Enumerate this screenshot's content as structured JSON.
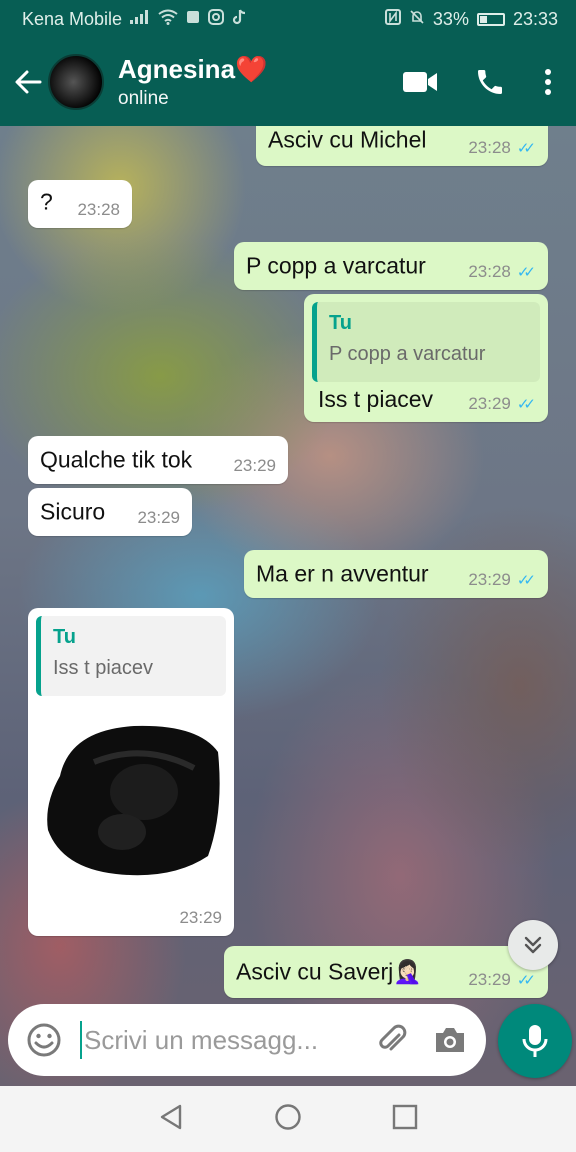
{
  "status_bar": {
    "carrier": "Kena Mobile",
    "battery": "33%",
    "battery_level": 0.33,
    "time": "23:33"
  },
  "header": {
    "contact_name": "Agnesina❤️",
    "presence": "online"
  },
  "messages": [
    {
      "direction": "out",
      "text": "Asciv cu Michel",
      "time": "23:28",
      "read": true
    },
    {
      "direction": "in",
      "text": "?",
      "time": "23:28"
    },
    {
      "direction": "out",
      "text": "P copp a varcatur",
      "time": "23:28",
      "read": true
    },
    {
      "direction": "out",
      "reply_to": {
        "author": "Tu",
        "text": "P copp a varcatur"
      },
      "text": "Iss t piacev",
      "time": "23:29",
      "read": true
    },
    {
      "direction": "in",
      "text": "Qualche tik tok",
      "time": "23:29"
    },
    {
      "direction": "in",
      "text": "Sicuro",
      "time": "23:29"
    },
    {
      "direction": "out",
      "text": "Ma er n avventur",
      "time": "23:29",
      "read": true
    },
    {
      "direction": "in",
      "reply_to": {
        "author": "Tu",
        "text": "Iss t piacev"
      },
      "sticker": "face-sticker",
      "time": "23:29"
    },
    {
      "direction": "out",
      "text": "Asciv cu Saverj🤦🏻‍♀️",
      "time": "23:29",
      "read": true
    }
  ],
  "composer": {
    "placeholder": "Scrivi un messagg..."
  },
  "colors": {
    "header_bg": "#075e54",
    "outgoing_bubble": "#dcf8c6",
    "incoming_bubble": "#ffffff",
    "read_ticks": "#34b7f1",
    "accent": "#00897b"
  },
  "icons": {
    "back": "arrow-left-icon",
    "video_call": "video-camera-icon",
    "voice_call": "phone-icon",
    "menu": "more-vert-icon",
    "emoji": "emoji-icon",
    "attach": "paperclip-icon",
    "camera": "camera-icon",
    "mic": "mic-icon",
    "scroll_down": "double-chevron-down-icon"
  }
}
